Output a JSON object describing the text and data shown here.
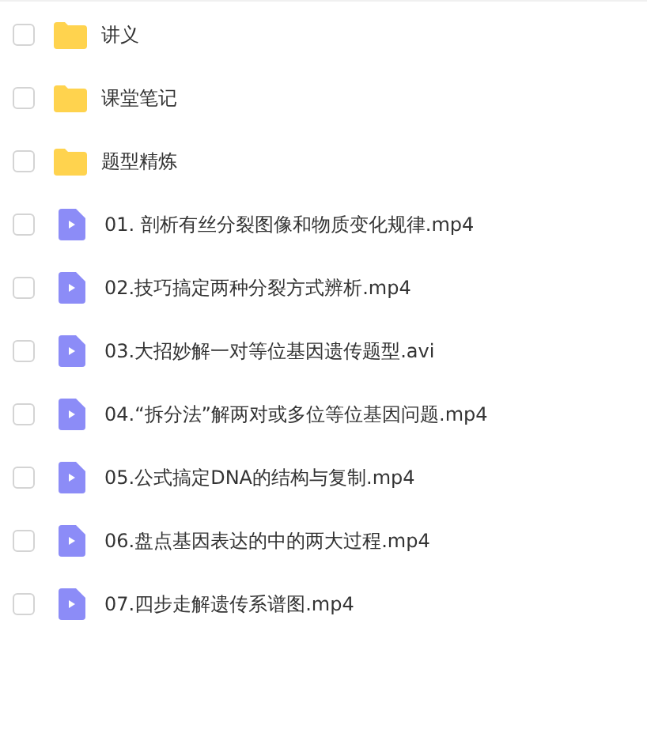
{
  "files": [
    {
      "kind": "folder",
      "name": "讲义",
      "checked": false
    },
    {
      "kind": "folder",
      "name": "课堂笔记",
      "checked": false
    },
    {
      "kind": "folder",
      "name": "题型精炼",
      "checked": false
    },
    {
      "kind": "video",
      "name": "01. 剖析有丝分裂图像和物质变化规律.mp4",
      "checked": false
    },
    {
      "kind": "video",
      "name": "02.技巧搞定两种分裂方式辨析.mp4",
      "checked": false
    },
    {
      "kind": "video",
      "name": "03.大招妙解一对等位基因遗传题型.avi",
      "checked": false
    },
    {
      "kind": "video",
      "name": "04.“拆分法”解两对或多位等位基因问题.mp4",
      "checked": false
    },
    {
      "kind": "video",
      "name": "05.公式搞定DNA的结构与复制.mp4",
      "checked": false
    },
    {
      "kind": "video",
      "name": "06.盘点基因表达的中的两大过程.mp4",
      "checked": false
    },
    {
      "kind": "video",
      "name": "07.四步走解遗传系谱图.mp4",
      "checked": false
    }
  ]
}
